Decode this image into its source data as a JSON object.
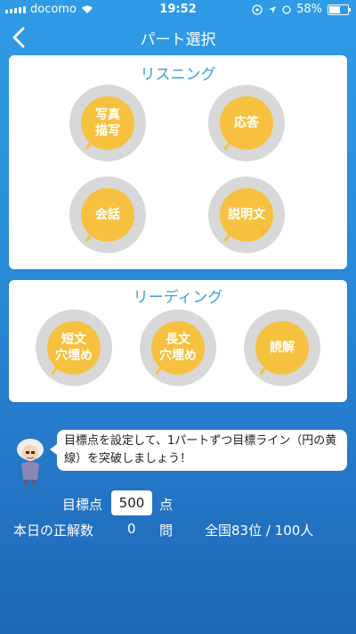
{
  "status": {
    "carrier": "docomo",
    "time": "19:52",
    "battery": "58%",
    "battery_level": 0.58
  },
  "nav": {
    "title": "パート選択"
  },
  "listening": {
    "title": "リスニング",
    "parts": [
      {
        "label": "写真\n描写"
      },
      {
        "label": "応答"
      },
      {
        "label": "会話"
      },
      {
        "label": "説明文"
      }
    ]
  },
  "reading": {
    "title": "リーディング",
    "parts": [
      {
        "label": "短文\n穴埋め"
      },
      {
        "label": "長文\n穴埋め"
      },
      {
        "label": "読解"
      }
    ]
  },
  "hint": {
    "text": "目標点を設定して、1パートずつ目標ライン（円の黄線）を突破しましょう！"
  },
  "target": {
    "label": "目標点",
    "value": "500",
    "unit": "点"
  },
  "today": {
    "label": "本日の正解数",
    "count": "0",
    "unit": "問",
    "rank": "全国83位 / 100人"
  },
  "colors": {
    "ring_gray": "#d8d8d8",
    "ring_yellow": "#f6c13e",
    "accent": "#3b9ed8"
  }
}
